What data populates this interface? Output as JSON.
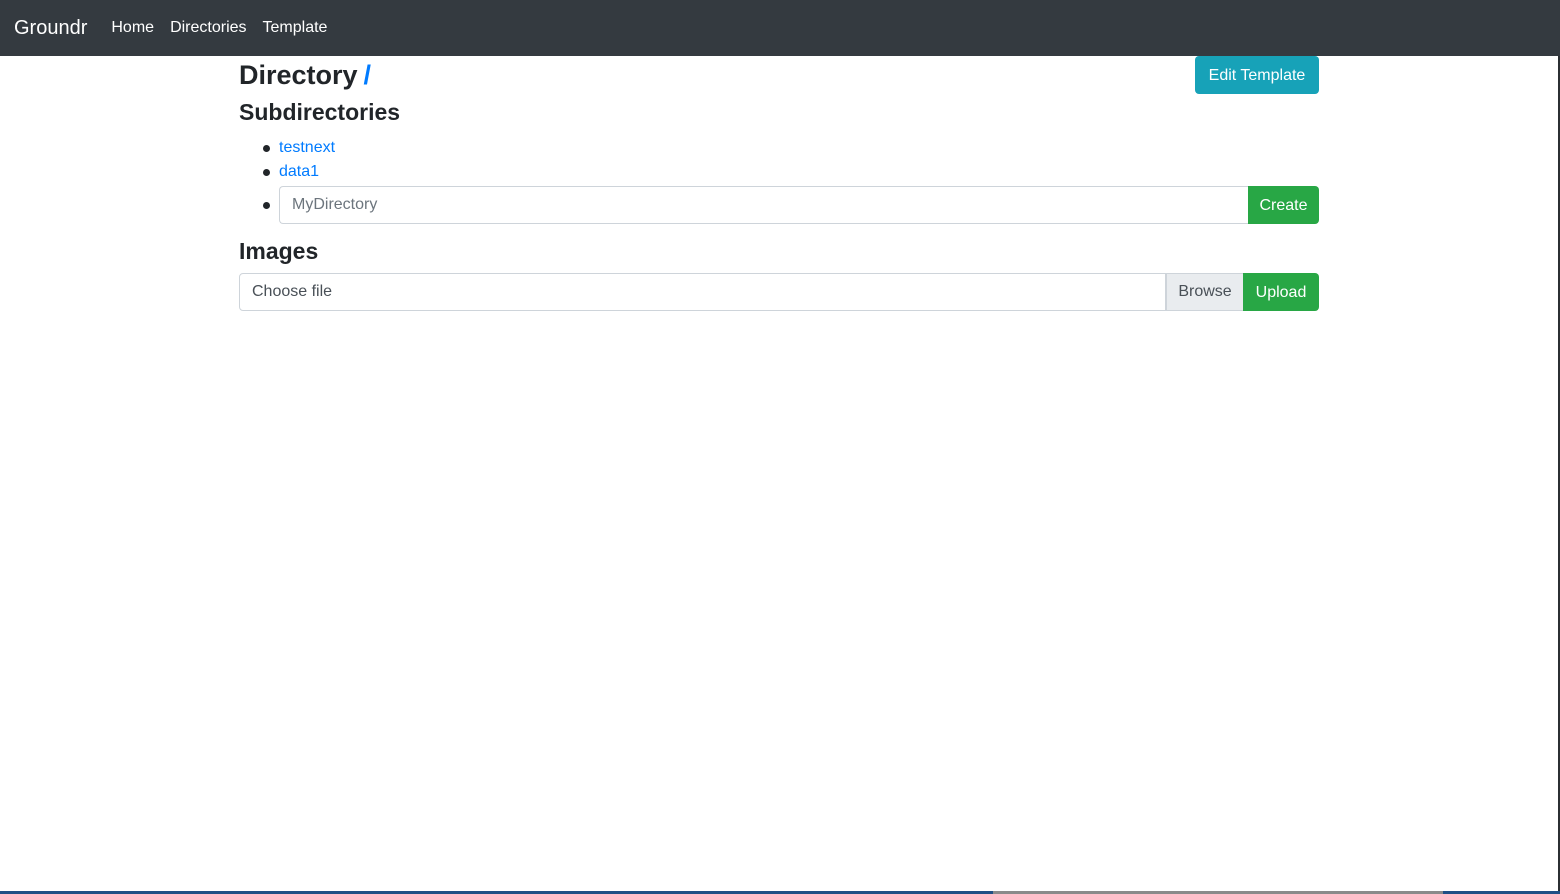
{
  "navbar": {
    "brand": "Groundr",
    "links": [
      "Home",
      "Directories",
      "Template"
    ]
  },
  "page": {
    "title": "Directory",
    "path": "/",
    "edit_template_label": "Edit Template"
  },
  "subdirectories": {
    "heading": "Subdirectories",
    "items": [
      "testnext",
      "data1"
    ],
    "new_dir_placeholder": "MyDirectory",
    "create_label": "Create"
  },
  "images": {
    "heading": "Images",
    "file_placeholder": "Choose file",
    "browse_label": "Browse",
    "upload_label": "Upload"
  },
  "colors": {
    "navbar": "#343a40",
    "link": "#007bff",
    "info": "#17a2b8",
    "success": "#28a745"
  }
}
